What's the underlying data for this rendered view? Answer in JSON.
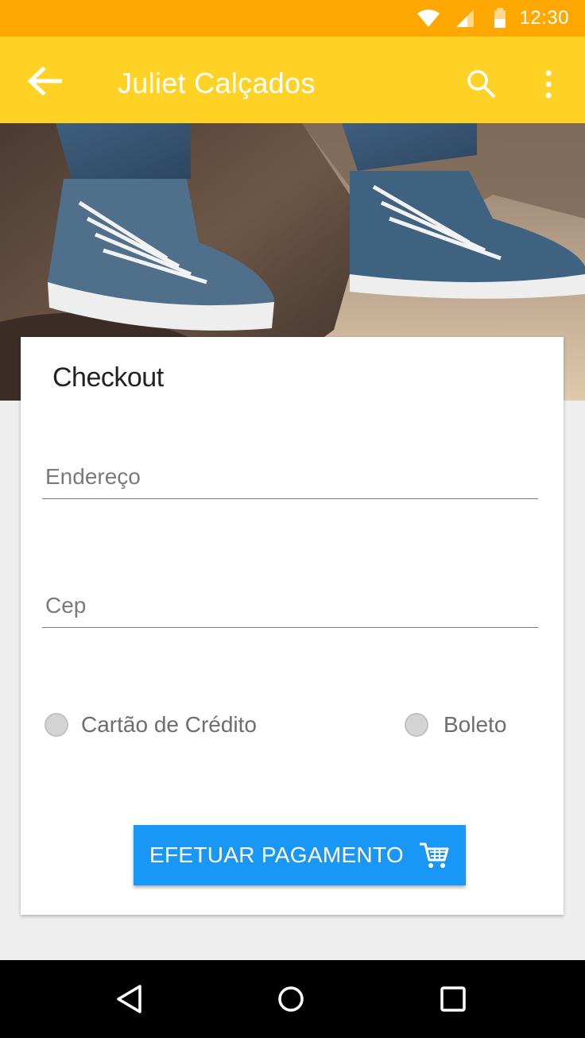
{
  "status_bar": {
    "time": "12:30",
    "icons": [
      "wifi-icon",
      "cell-signal-icon",
      "battery-icon"
    ]
  },
  "app_bar": {
    "title": "Juliet Calçados",
    "icons": [
      "back-arrow-icon",
      "search-icon",
      "more-vert-icon"
    ]
  },
  "hero": {
    "icon": "sneakers-photo"
  },
  "checkout": {
    "title": "Checkout",
    "address_placeholder": "Endereço",
    "zip_placeholder": "Cep",
    "payment_options": [
      {
        "label": "Cartão de Crédito",
        "selected": false
      },
      {
        "label": "Boleto",
        "selected": false
      }
    ],
    "pay_button_label": "EFETUAR PAGAMENTO",
    "pay_button_icon": "cart-icon"
  },
  "nav_bar": {
    "icons": [
      "nav-back-icon",
      "nav-home-icon",
      "nav-recents-icon"
    ]
  },
  "colors": {
    "status_bar": "#ffa703",
    "app_bar": "#ffd225",
    "button": "#1997f6",
    "background": "#eeeeee"
  }
}
